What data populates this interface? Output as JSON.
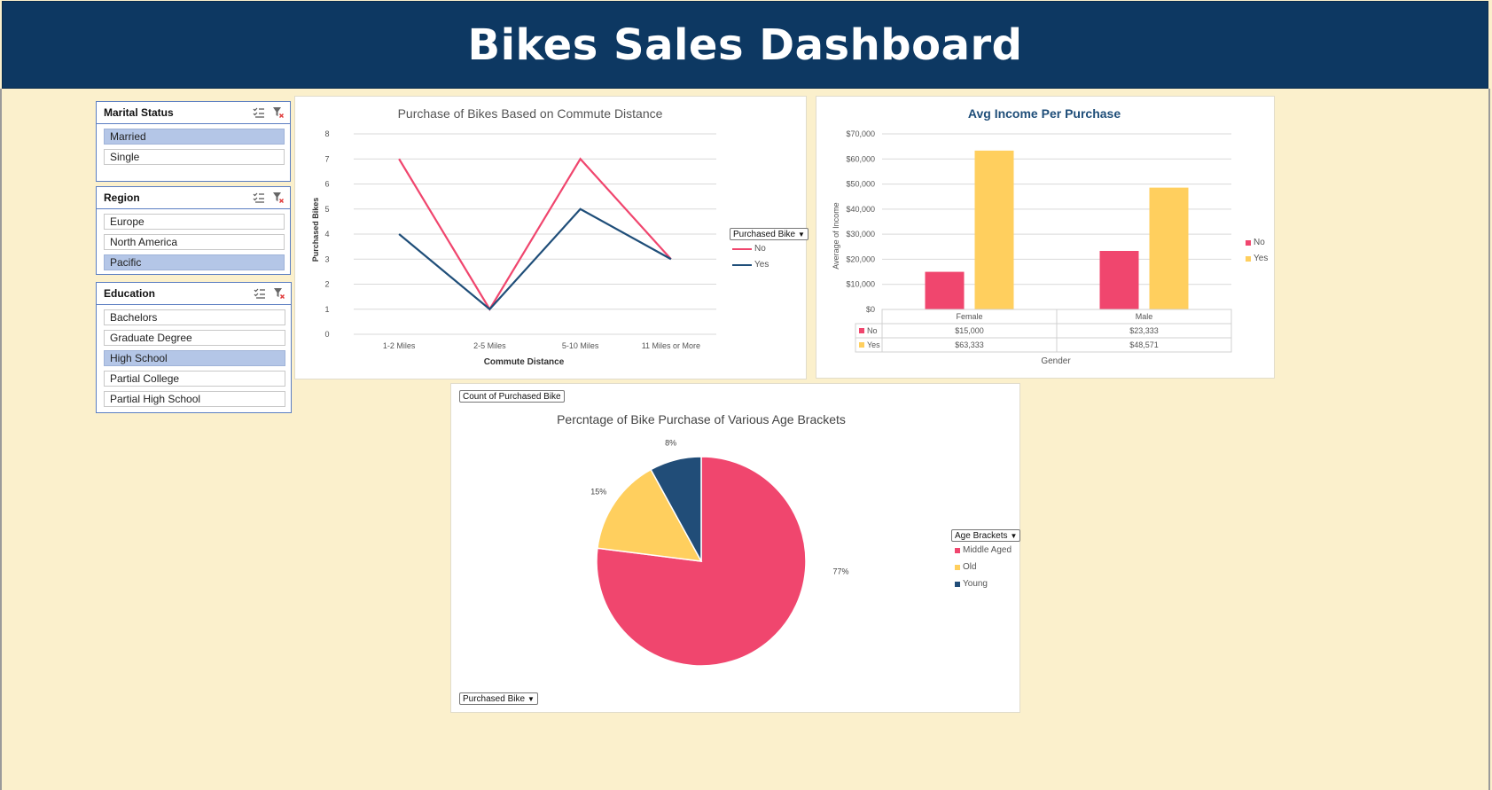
{
  "dashboard": {
    "title": "Bikes Sales Dashboard"
  },
  "colors": {
    "banner": "#0d3862",
    "no": "#f0466e",
    "yes": "#ffcf5e",
    "young": "#214d78",
    "yes_line": "#1f4e79",
    "selected": "#b4c6e7"
  },
  "slicers": [
    {
      "title": "Marital Status",
      "items": [
        {
          "label": "Married",
          "selected": true
        },
        {
          "label": "Single",
          "selected": false
        }
      ]
    },
    {
      "title": "Region",
      "items": [
        {
          "label": "Europe",
          "selected": false
        },
        {
          "label": "North America",
          "selected": false
        },
        {
          "label": "Pacific",
          "selected": true
        }
      ]
    },
    {
      "title": "Education",
      "items": [
        {
          "label": "Bachelors",
          "selected": false
        },
        {
          "label": "Graduate Degree",
          "selected": false
        },
        {
          "label": "High School",
          "selected": true
        },
        {
          "label": "Partial College",
          "selected": false
        },
        {
          "label": "Partial High School",
          "selected": false
        }
      ]
    }
  ],
  "commute_chart": {
    "legend_field": "Purchased Bike"
  },
  "income_chart": {
    "table_labels": [
      "No",
      "Yes"
    ]
  },
  "pie_chart": {
    "value_field": "Count of Purchased Bike",
    "series_field": "Purchased Bike",
    "legend_field": "Age Brackets"
  },
  "chart_data": [
    {
      "type": "line",
      "title": "Purchase of Bikes Based on Commute Distance",
      "xlabel": "Commute Distance",
      "ylabel": "Purchased Bikes",
      "categories": [
        "1-2 Miles",
        "2-5 Miles",
        "5-10 Miles",
        "11 Miles or More"
      ],
      "ylim": [
        0,
        8
      ],
      "yticks": [
        "0",
        "1",
        "2",
        "3",
        "4",
        "5",
        "6",
        "7",
        "8"
      ],
      "series": [
        {
          "name": "No",
          "values": [
            7,
            1,
            7,
            3
          ]
        },
        {
          "name": "Yes",
          "values": [
            4,
            1,
            5,
            3
          ]
        }
      ],
      "grid": true,
      "legend": "right"
    },
    {
      "type": "bar",
      "title": "Avg Income Per Purchase",
      "xlabel": "Gender",
      "ylabel": "Average of Income",
      "categories": [
        "Female",
        "Male"
      ],
      "ylim": [
        0,
        70000
      ],
      "yticks": [
        "$0",
        "$10,000",
        "$20,000",
        "$30,000",
        "$40,000",
        "$50,000",
        "$60,000",
        "$70,000"
      ],
      "series": [
        {
          "name": "No",
          "values": [
            15000,
            23333
          ],
          "labels": [
            "$15,000",
            "$23,333"
          ]
        },
        {
          "name": "Yes",
          "values": [
            63333,
            48571
          ],
          "labels": [
            "$63,333",
            "$48,571"
          ]
        }
      ],
      "grid": true,
      "legend": "right"
    },
    {
      "type": "pie",
      "title": "Percntage of Bike Purchase of Various Age Brackets",
      "categories": [
        "Middle Aged",
        "Old",
        "Young"
      ],
      "values": [
        77,
        15,
        8
      ],
      "labels": [
        "77%",
        "15%",
        "8%"
      ],
      "legend": "right"
    }
  ]
}
